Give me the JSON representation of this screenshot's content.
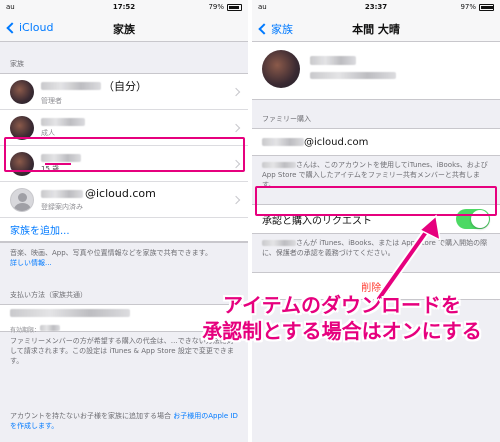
{
  "left": {
    "status": {
      "carrier": "au",
      "time": "17:52",
      "battery": "79%",
      "battery_level": 0.79
    },
    "nav": {
      "back_label": "iCloud",
      "title": "家族"
    },
    "family_header": "家族",
    "members": [
      {
        "role": "管理者",
        "suffix": "（自分）"
      },
      {
        "role": "成人"
      },
      {
        "role": "15 歳"
      },
      {
        "email_suffix": "@icloud.com",
        "role": "登録案内済み"
      }
    ],
    "add_family": "家族を追加...",
    "share_note": "音楽、映画、App、写真や位置情報などを家族で共有できます。",
    "details_link": "詳しい情報...",
    "payment_header": "支払い方法（家族共通）",
    "payment_sub": "有効期限：",
    "payment_note": "ファミリーメンバーの方が希望する購入の代金は、…できない方法に対して請求されます。この設定は iTunes & App Store 設定で変更できます。",
    "bottom_note": "アカウントを持たないお子様を家族に追加する場合",
    "bottom_link": "お子様用のApple ID",
    "bottom_link2": "を作成します。"
  },
  "right": {
    "status": {
      "carrier": "au",
      "time": "23:37",
      "battery": "97%",
      "battery_level": 0.97
    },
    "nav": {
      "back_label": "家族",
      "title": "本間 大晴"
    },
    "family_purchase_header": "ファミリー購入",
    "email_suffix": "@icloud.com",
    "purchase_note": "さんは、このアカウントを使用してiTunes、iBooks、および App Store で購入したアイテムをファミリー共有メンバーと共有します。",
    "ask_to_buy_label": "承認と購入のリクエスト",
    "ask_to_buy_on": true,
    "ask_note": "さんが iTunes、iBooks、または App Store で購入開始の際に、保護者の承認を義務づけてください。",
    "delete_label": "削除..."
  },
  "callout": {
    "line1": "アイテムのダウンロードを",
    "line2": "承認制とする場合はオンにする"
  },
  "colors": {
    "accent": "#007aff",
    "annotation": "#e6007e",
    "switch_on": "#4cd964"
  }
}
